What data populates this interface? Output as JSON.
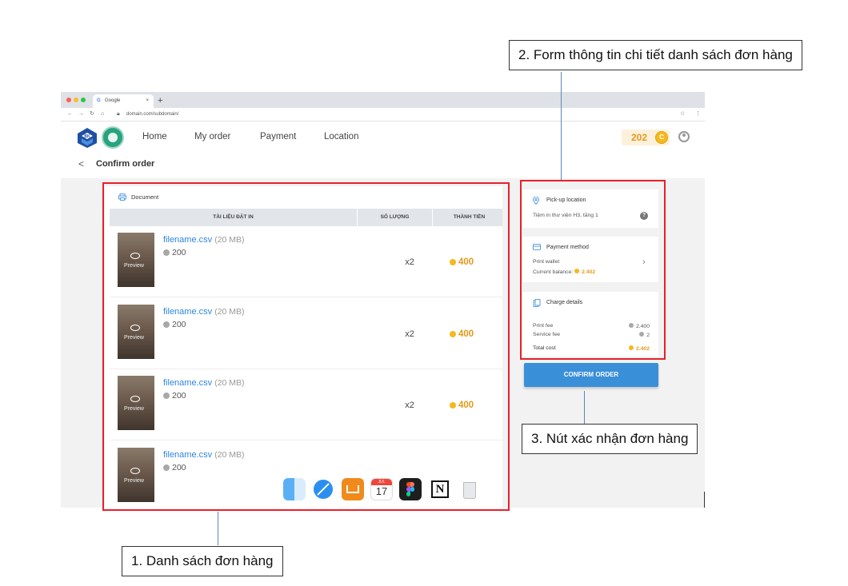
{
  "browser": {
    "tab_title": "Google",
    "tab_close": "×",
    "new_tab": "+",
    "url": "domain.com/subdomain/"
  },
  "header": {
    "nav": [
      "Home",
      "My order",
      "Payment",
      "Location"
    ],
    "coin_balance": "202",
    "coin_symbol": "C"
  },
  "page": {
    "back_symbol": "<",
    "title": "Confirm order"
  },
  "document_list": {
    "section_title": "Document",
    "columns": [
      "TÀI LIỆU ĐẶT IN",
      "SỐ LƯỢNG",
      "THÀNH TIỀN"
    ],
    "preview_label": "Preview",
    "items": [
      {
        "filename": "filename.csv",
        "size": "(20 MB)",
        "cost": "200",
        "qty": "x2",
        "total": "400"
      },
      {
        "filename": "filename.csv",
        "size": "(20 MB)",
        "cost": "200",
        "qty": "x2",
        "total": "400"
      },
      {
        "filename": "filename.csv",
        "size": "(20 MB)",
        "cost": "200",
        "qty": "x2",
        "total": "400"
      },
      {
        "filename": "filename.csv",
        "size": "(20 MB)",
        "cost": "200",
        "qty": "",
        "total": ""
      }
    ]
  },
  "pickup": {
    "title": "Pick-up location",
    "value": "Tiệm in thư viện H3, tầng 1",
    "help": "?"
  },
  "payment": {
    "title": "Payment method",
    "method": "Print wallet",
    "balance_label": "Current balance:",
    "balance_value": "2.402",
    "chevron": "›"
  },
  "charges": {
    "title": "Charge details",
    "print_fee_label": "Print fee",
    "print_fee_value": "2.400",
    "service_fee_label": "Service fee",
    "service_fee_value": "2",
    "total_label": "Total cost",
    "total_value": "2.402"
  },
  "confirm_button": "CONFIRM ORDER",
  "dock": {
    "calendar_month": "JUL",
    "calendar_day": "17",
    "notion_letter": "N"
  },
  "annotations": {
    "list": "1. Danh sách đơn hàng",
    "form": "2. Form thông tin chi tiết danh sách đơn hàng",
    "button": "3. Nút xác nhận đơn hàng"
  },
  "colors": {
    "annotation_red": "#e8202a",
    "primary_blue": "#3a8fd9",
    "coin_gold": "#f5b91e",
    "link_blue": "#2e86de"
  }
}
